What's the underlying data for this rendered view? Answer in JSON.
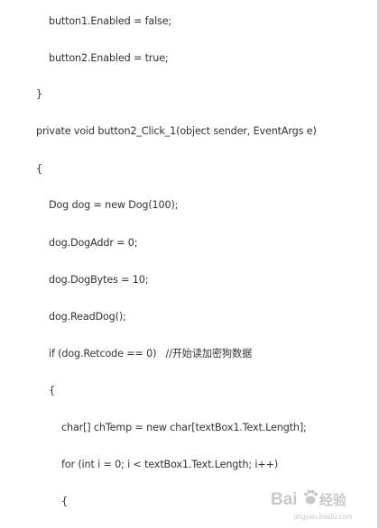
{
  "code_lines": [
    {
      "text": "button1.Enabled = false;"
    },
    {
      "text": "button2.Enabled = true;"
    },
    {
      "text": "}"
    },
    {
      "text": "private void button2_Click_1(object sender, EventArgs e)"
    },
    {
      "text": "{"
    },
    {
      "text": "Dog dog = new Dog(100);"
    },
    {
      "text": "dog.DogAddr = 0;"
    },
    {
      "text": "dog.DogBytes = 10;"
    },
    {
      "text": "dog.ReadDog();"
    },
    {
      "text": "if (dog.Retcode == 0)   //开始读加密狗数据"
    },
    {
      "text": "{"
    },
    {
      "text": "char[] chTemp = new char[textBox1.Text.Length];"
    },
    {
      "text": "for (int i = 0; i < textBox1.Text.Length; i++)"
    },
    {
      "text": "{"
    }
  ],
  "watermark": {
    "brand": "Bai",
    "suffix": "经验",
    "domain": "jingyan.baidu.com",
    "icon": "baidu-paw-icon"
  }
}
